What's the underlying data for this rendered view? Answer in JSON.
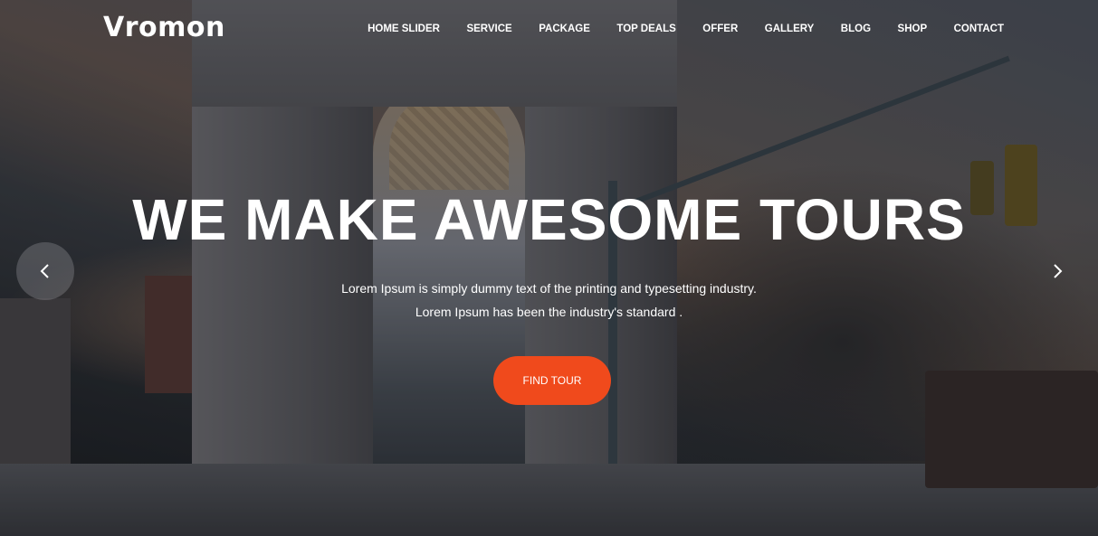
{
  "brand": {
    "logo_text": "Vromon"
  },
  "nav": {
    "items": [
      {
        "label": "HOME SLIDER"
      },
      {
        "label": "SERVICE"
      },
      {
        "label": "PACKAGE"
      },
      {
        "label": "TOP DEALS"
      },
      {
        "label": "OFFER"
      },
      {
        "label": "GALLERY"
      },
      {
        "label": "BLOG"
      },
      {
        "label": "SHOP"
      },
      {
        "label": "CONTACT"
      }
    ]
  },
  "hero": {
    "headline": "WE MAKE AWESOME TOURS",
    "subtext_line1": "Lorem Ipsum is simply dummy text of the printing and typesetting industry.",
    "subtext_line2": "Lorem Ipsum has been the industry's standard .",
    "cta_label": "FIND TOUR",
    "prev_icon": "chevron-left-icon",
    "next_icon": "chevron-right-icon"
  },
  "colors": {
    "accent": "#f04a1c",
    "text": "#ffffff"
  }
}
